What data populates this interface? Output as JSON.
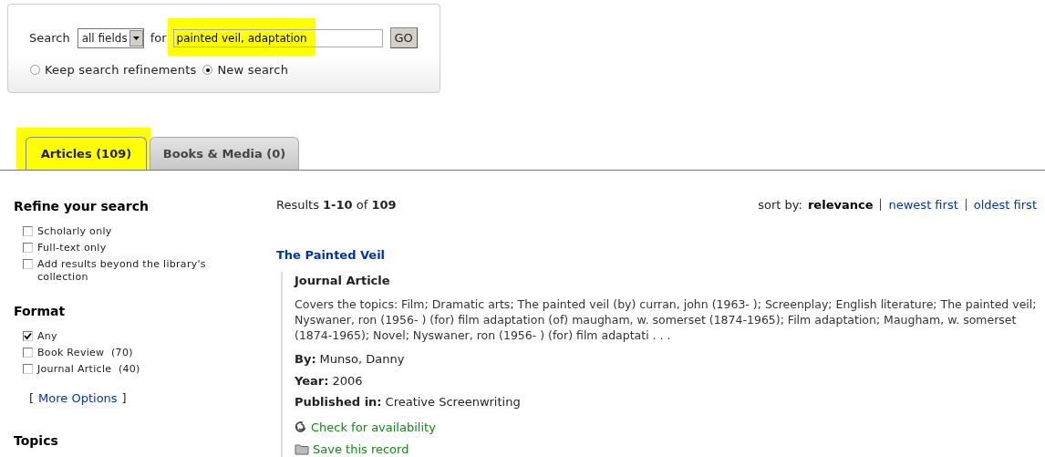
{
  "search": {
    "label": "Search",
    "field_select": "all fields",
    "for_label": "for",
    "query": "painted veil, adaptation",
    "query_highlighted": true,
    "go": "GO",
    "modes": [
      {
        "label": "Keep search refinements",
        "selected": false
      },
      {
        "label": "New search",
        "selected": true
      }
    ]
  },
  "tabs": [
    {
      "label": "Articles (109)",
      "selected": true,
      "highlighted": true
    },
    {
      "label": "Books & Media (0)",
      "selected": false,
      "highlighted": false
    }
  ],
  "sidebar": {
    "title": "Refine your search",
    "refine": [
      {
        "label": "Scholarly only",
        "checked": false
      },
      {
        "label": "Full-text only",
        "checked": false
      },
      {
        "label": "Add results beyond the library's collection",
        "checked": false
      }
    ],
    "format_title": "Format",
    "formats": [
      {
        "label": "Any",
        "checked": true
      },
      {
        "label": "Book Review  (70)",
        "checked": false
      },
      {
        "label": "Journal Article  (40)",
        "checked": false
      }
    ],
    "more_open": "[",
    "more": "More Options",
    "more_close": "]",
    "next_title": "Topics"
  },
  "results": {
    "summary": "Results **1-10** of **109**",
    "sort_label": "sort by:",
    "sort_options": [
      {
        "label": "relevance",
        "selected": true
      },
      {
        "label": "newest first",
        "selected": false
      },
      {
        "label": "oldest first",
        "selected": false
      }
    ]
  },
  "records": [
    {
      "title": "The Painted Veil",
      "type": "Journal Article",
      "description": "Covers the topics: Film; Dramatic arts; The painted veil (by) curran, john (1963- ); Screenplay; English literature; The painted veil; Nyswaner, ron (1956- ) (for) film adaptation (of) maugham, w. somerset (1874-1965); Film adaptation; Maugham, w. somerset (1874-1965); Novel; Nyswaner, ron (1956- ) (for) film adaptati . . .",
      "fields": [
        {
          "label": "By:",
          "value": "Munso, Danny"
        },
        {
          "label": "Year:",
          "value": "2006"
        },
        {
          "label": "Published in:",
          "value": "Creative Screenwriting"
        }
      ],
      "actions": [
        {
          "kind": "availability",
          "label": "Check for availability"
        },
        {
          "kind": "save",
          "label": "Save this record"
        }
      ]
    }
  ]
}
